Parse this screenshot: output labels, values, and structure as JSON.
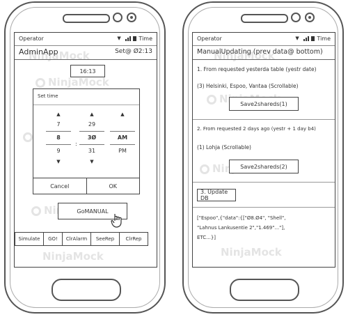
{
  "left": {
    "status": {
      "carrier": "Operator",
      "time": "Time"
    },
    "title": "AdminApp",
    "set_label": "Set@ Ø2:13",
    "time_field": "16:13",
    "dialog": {
      "title": "Set time",
      "hours": [
        "7",
        "8",
        "9"
      ],
      "minutes": [
        "29",
        "3Ø",
        "31"
      ],
      "ampm": [
        "",
        "AM",
        "PM"
      ],
      "separator": ":",
      "cancel": "Cancel",
      "ok": "OK"
    },
    "gomanual": "GoMANUAL",
    "bottom_buttons": [
      "Simulate",
      "GO!",
      "ClrAlarm",
      "SeeRep",
      "ClrRep"
    ]
  },
  "right": {
    "status": {
      "carrier": "Operator",
      "time": "Time"
    },
    "title": "ManualUpdating (prev data@ bottom)",
    "step1": "1. From requested yesterda table (yestr date)",
    "step1_cities": "(3) Helsinki, Espoo, Vantaa (Scrollable)",
    "save1": "Save2shareds(1)",
    "step2": "2. From requested 2 days ago (yestr + 1 day b4)",
    "step2_cities": "(1) Lohja (Scrollable)",
    "save2": "Save2shareds(2)",
    "update_db": "3. Update DB",
    "json_line1": "[\"Espoo\",{\"data\":{[\"Ø8.Ø4\", \"Shell\",",
    "json_line2": "\"Lahnus Lankusentie 2\",\"1.469\"...\"],",
    "json_line3": "ETC...}]"
  },
  "watermark_text": "NinjaMock"
}
